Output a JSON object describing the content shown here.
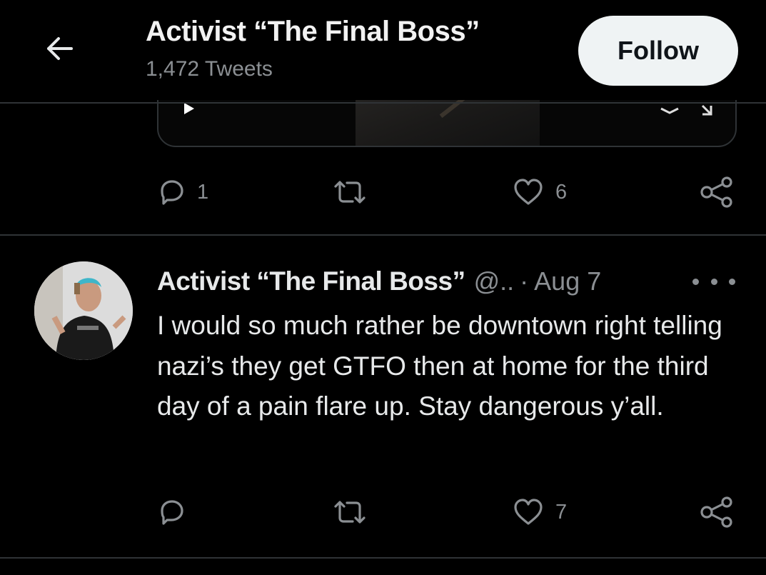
{
  "header": {
    "back_icon": "arrow-left-icon",
    "name": "Activist “The Final Boss”",
    "tweet_count": "1,472 Tweets",
    "follow_label": "Follow"
  },
  "prev_tweet": {
    "media": "video",
    "replies": "1",
    "retweets": "",
    "likes": "6"
  },
  "tweet": {
    "author_name": "Activist “The Final Boss”",
    "handle": "@..",
    "separator": "·",
    "date": "Aug 7",
    "text": "I would so much rather be downtown right telling nazi’s they get GTFO then at home for the third day of a pain flare up. Stay dangerous y’all.",
    "replies": "",
    "retweets": "",
    "likes": "7"
  },
  "colors": {
    "background": "#000000",
    "text_primary": "#e7e9ea",
    "text_secondary": "#8b8f93",
    "divider": "#2f3336",
    "follow_bg": "#eff3f4"
  }
}
